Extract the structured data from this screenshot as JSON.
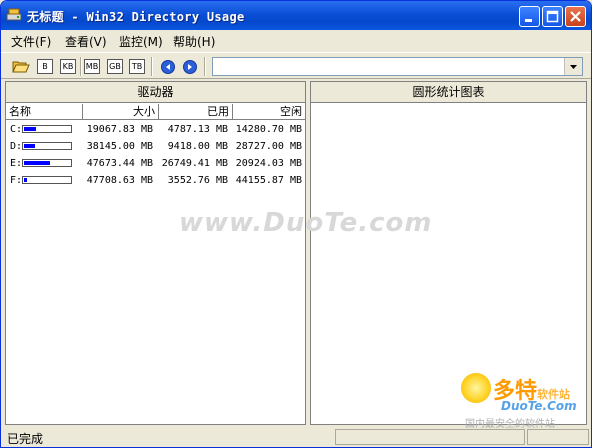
{
  "window": {
    "title": "无标题 - Win32 Directory Usage",
    "buttons": {
      "minimize": "minimize",
      "maximize": "maximize",
      "close": "close"
    }
  },
  "menu": [
    {
      "label": "文件(F)"
    },
    {
      "label": "查看(V)"
    },
    {
      "label": "监控(M)"
    },
    {
      "label": "帮助(H)"
    }
  ],
  "toolbar": {
    "units": [
      "B",
      "KB",
      "MB",
      "GB",
      "TB"
    ],
    "path_value": ""
  },
  "drives_panel": {
    "title": "驱动器",
    "columns": [
      "名称",
      "大小",
      "已用",
      "空闲"
    ],
    "rows": [
      {
        "name": "C:",
        "size": "19067.83 MB",
        "used": "4787.13 MB",
        "free": "14280.70 MB",
        "used_fraction": 0.251
      },
      {
        "name": "D:",
        "size": "38145.00 MB",
        "used": "9418.00 MB",
        "free": "28727.00 MB",
        "used_fraction": 0.247
      },
      {
        "name": "E:",
        "size": "47673.44 MB",
        "used": "26749.41 MB",
        "free": "20924.03 MB",
        "used_fraction": 0.561
      },
      {
        "name": "F:",
        "size": "47708.63 MB",
        "used": "3552.76 MB",
        "free": "44155.87 MB",
        "used_fraction": 0.074
      }
    ]
  },
  "pie_panel": {
    "title": "圆形统计图表"
  },
  "status": {
    "text": "已完成"
  },
  "watermark": {
    "text": "www.DuoTe.com"
  },
  "logo": {
    "line1": "多特",
    "line1_small": "软件站",
    "line2": "DuoTe.Com",
    "line3": "国内最安全的软件站"
  },
  "colors": {
    "titlebar": "#0a4fd6",
    "bar_fill": "#0000ff",
    "chrome": "#ece9d8"
  }
}
